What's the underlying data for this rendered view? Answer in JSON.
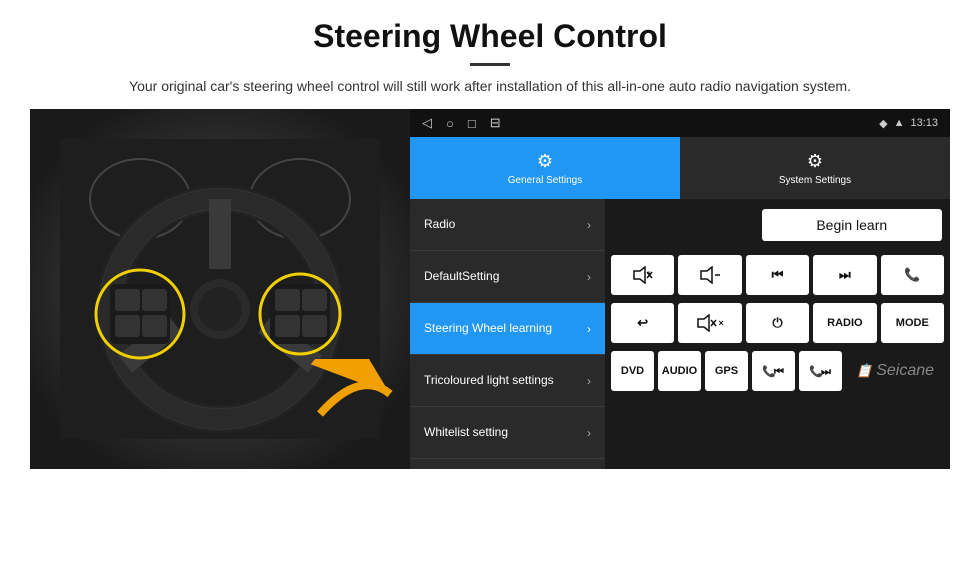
{
  "header": {
    "title": "Steering Wheel Control",
    "description": "Your original car's steering wheel control will still work after installation of this all-in-one auto radio navigation system."
  },
  "status_bar": {
    "nav_icons": [
      "◁",
      "○",
      "□",
      "⊟"
    ],
    "right_icons": [
      "◆",
      "▲",
      "13:13"
    ]
  },
  "tabs": [
    {
      "label": "General Settings",
      "active": true
    },
    {
      "label": "System Settings",
      "active": false
    }
  ],
  "menu_items": [
    {
      "label": "Radio",
      "active": false
    },
    {
      "label": "DefaultSetting",
      "active": false
    },
    {
      "label": "Steering Wheel learning",
      "active": true
    },
    {
      "label": "Tricoloured light settings",
      "active": false
    },
    {
      "label": "Whitelist setting",
      "active": false
    }
  ],
  "controls": {
    "begin_learn": "Begin learn",
    "row1": [
      "🔊+",
      "🔊–",
      "⏮",
      "⏭",
      "📞"
    ],
    "row1_symbols": [
      "🔊+",
      "🔊–",
      "|◀◀",
      "▶▶|",
      "☎"
    ],
    "row2_symbols": [
      "↩",
      "🔇",
      "⏻",
      "RADIO",
      "MODE"
    ],
    "row3_symbols": [
      "DVD",
      "AUDIO",
      "GPS",
      "📞⏮",
      "📞⏭"
    ]
  },
  "seicane_logo": "Seicane"
}
